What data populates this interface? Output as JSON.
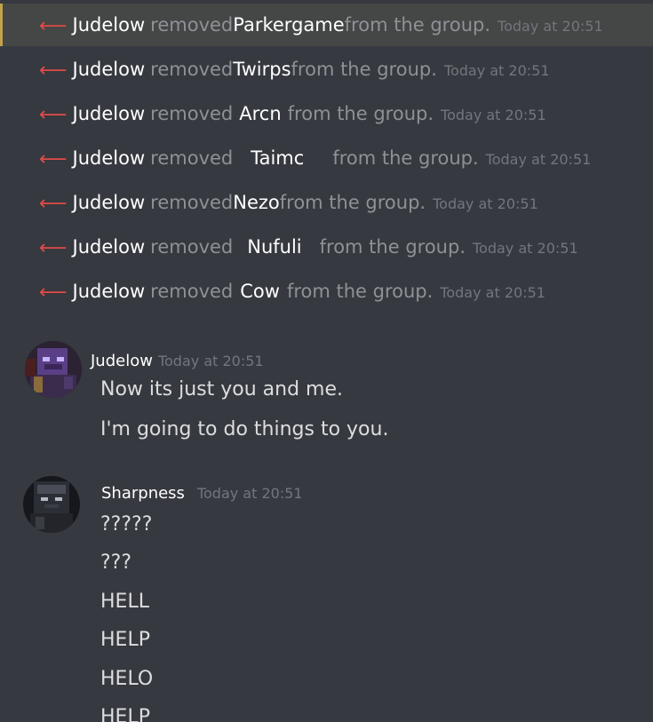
{
  "system_messages": [
    {
      "actor": "Judelow",
      "verb": "removed",
      "target": "Parkergame",
      "tail": "from the group.",
      "time": "Today at 20:51"
    },
    {
      "actor": "Judelow",
      "verb": "removed",
      "target": "Twirps",
      "tail": "from the group.",
      "time": "Today at 20:51"
    },
    {
      "actor": "Judelow",
      "verb": "removed",
      "target": "Arcn",
      "tail": "from the group.",
      "time": "Today at 20:51"
    },
    {
      "actor": "Judelow",
      "verb": "removed",
      "target": "Taimc",
      "tail": "from the group.",
      "time": "Today at 20:51"
    },
    {
      "actor": "Judelow",
      "verb": "removed",
      "target": "Nezo",
      "tail": "from the group.",
      "time": "Today at 20:51"
    },
    {
      "actor": "Judelow",
      "verb": "removed",
      "target": "Nufuli",
      "tail": "from the group.",
      "time": "Today at 20:51"
    },
    {
      "actor": "Judelow",
      "verb": "removed",
      "target": "Cow",
      "tail": "from the group.",
      "time": "Today at 20:51"
    }
  ],
  "messages": [
    {
      "author": "Judelow",
      "time": "Today at 20:51",
      "lines": [
        "Now its just you and me.",
        "I'm going to do things to you."
      ]
    },
    {
      "author": "Sharpness",
      "time": "Today at 20:51",
      "lines": [
        "?????",
        "???",
        "HELL",
        "HELP",
        "HELO",
        "HELP"
      ]
    }
  ],
  "colors": {
    "background": "#36393f",
    "highlight": "#444745",
    "highlight_bar": "#c4a24b",
    "leave_arrow": "#e04a4a",
    "muted_text": "#8e9297",
    "timestamp": "#72767d",
    "message_text": "#dcddde"
  },
  "icons": {
    "leave_arrow": "left-arrow-icon"
  }
}
